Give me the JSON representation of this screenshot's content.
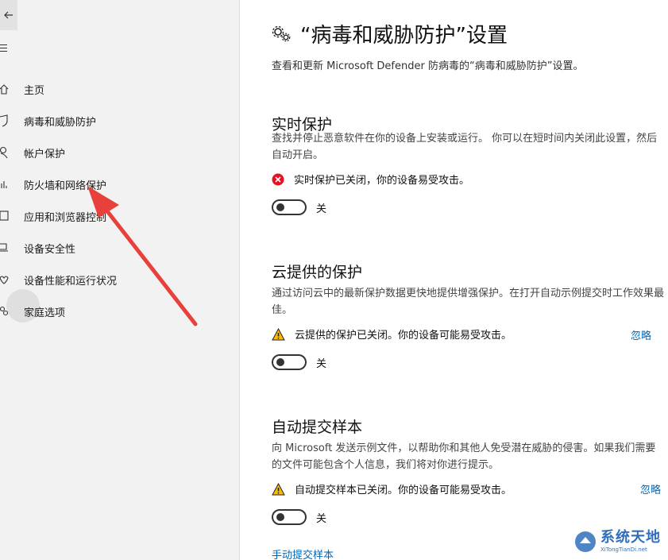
{
  "sidebar": {
    "items": [
      {
        "label": "主页",
        "icon": "home-icon"
      },
      {
        "label": "病毒和威胁防护",
        "icon": "shield-icon"
      },
      {
        "label": "帐户保护",
        "icon": "person-icon"
      },
      {
        "label": "防火墙和网络保护",
        "icon": "wifi-icon"
      },
      {
        "label": "应用和浏览器控制",
        "icon": "app-window-icon"
      },
      {
        "label": "设备安全性",
        "icon": "laptop-icon"
      },
      {
        "label": "设备性能和运行状况",
        "icon": "heart-icon"
      },
      {
        "label": "家庭选项",
        "icon": "family-icon"
      }
    ]
  },
  "main": {
    "title": "“病毒和威胁防护”设置",
    "subtitle": "查看和更新 Microsoft Defender 防病毒的“病毒和威胁防护”设置。",
    "sections": [
      {
        "title": "实时保护",
        "description": "查找并停止恶意软件在你的设备上安装或运行。 你可以在短时间内关闭此设置，然后自动开启。",
        "status": "实时保护已关闭，你的设备易受攻击。",
        "status_type": "error",
        "toggle_state": "关",
        "toggle_on": false
      },
      {
        "title": "云提供的保护",
        "description": "通过访问云中的最新保护数据更快地提供增强保护。在打开自动示例提交时工作效果最佳。",
        "status": "云提供的保护已关闭。你的设备可能易受攻击。",
        "status_type": "warning",
        "dismiss": "忽略",
        "toggle_state": "关",
        "toggle_on": false
      },
      {
        "title": "自动提交样本",
        "description": "向 Microsoft 发送示例文件，以帮助你和其他人免受潜在威胁的侵害。如果我们需要的文件可能包含个人信息，我们将对你进行提示。",
        "status": "自动提交样本已关闭。你的设备可能易受攻击。",
        "status_type": "warning",
        "dismiss": "忽略",
        "toggle_state": "关",
        "toggle_on": false
      }
    ],
    "manual_submit": "手动提交样本"
  },
  "watermark": {
    "cn": "系统天地",
    "en": "XiTongTianDi.net"
  },
  "colors": {
    "sidebar_bg": "#f2f2f2",
    "link": "#0067b8",
    "error": "#e81123",
    "warning": "#ffb900",
    "annotation_arrow": "#e8413c"
  }
}
